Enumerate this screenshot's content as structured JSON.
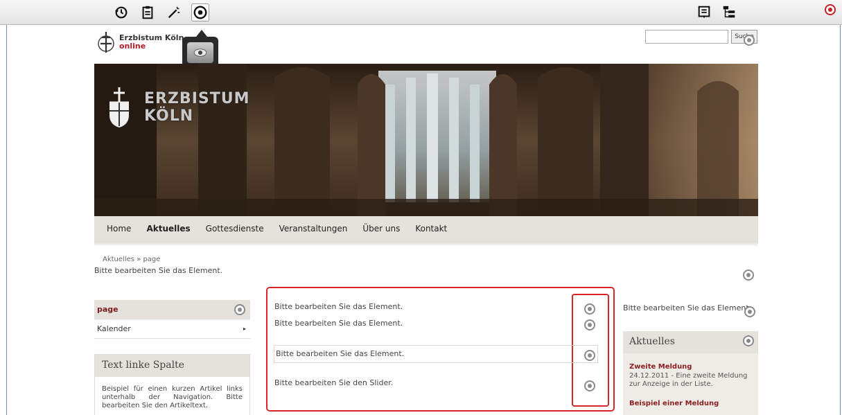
{
  "toolbar": {
    "icons": [
      "history-icon",
      "clipboard-icon",
      "magic-wand-icon",
      "target-icon",
      "list-icon",
      "tree-icon"
    ]
  },
  "logo": {
    "line1": "Erzbistum Köln",
    "line2": "online"
  },
  "search": {
    "placeholder": "",
    "button_label": "Suche"
  },
  "hero": {
    "title_line1": "ERZBISTUM",
    "title_line2": "KÖLN"
  },
  "nav": {
    "items": [
      "Home",
      "Aktuelles",
      "Gottesdienste",
      "Veranstaltungen",
      "Über uns",
      "Kontakt"
    ],
    "active": "Aktuelles"
  },
  "breadcrumb": "Aktuelles  »  page",
  "edit_placeholder": "Bitte bearbeiten Sie das Element.",
  "slider_placeholder": "Bitte bearbeiten Sie den Slider.",
  "sidebar": {
    "items": [
      "page",
      "Kalender"
    ],
    "text_box_title": "Text linke Spalte",
    "text_box_body": "Beispiel für einen kurzen Artikel links unterhalb der Navigation. Bitte bearbeiten Sie den Artikeltext."
  },
  "aktuelles": {
    "title": "Aktuelles",
    "news1_title": "Zweite Meldung",
    "news1_text": "24.12.2011 - Eine zweite Meldung zur Anzeige in der Liste.",
    "news2_title": "Beispiel einer Meldung"
  },
  "colors": {
    "accent": "#d8262a",
    "nav_bg": "#e5e1dc",
    "link": "#8a1f1f"
  }
}
